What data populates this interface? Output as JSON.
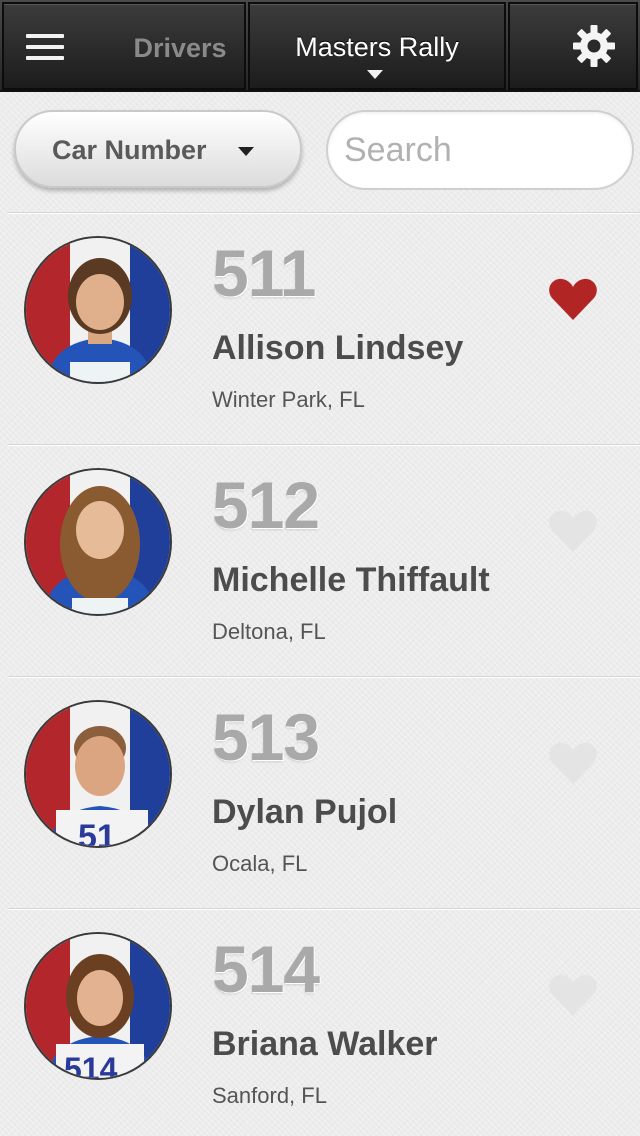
{
  "header": {
    "back_label": "Drivers",
    "title": "Masters Rally",
    "menu_icon": "hamburger-menu-icon",
    "settings_icon": "gear-icon"
  },
  "filters": {
    "sort_label": "Car Number",
    "search_placeholder": "Search",
    "search_value": ""
  },
  "colors": {
    "favorite_on": "#b22525",
    "favorite_off": "#e4e4e4",
    "number_gray": "#a9a9a9"
  },
  "drivers": [
    {
      "number": "511",
      "name": "Allison Lindsey",
      "location": "Winter Park, FL",
      "favorite": true
    },
    {
      "number": "512",
      "name": "Michelle Thiffault",
      "location": "Deltona, FL",
      "favorite": false
    },
    {
      "number": "513",
      "name": "Dylan Pujol",
      "location": "Ocala, FL",
      "favorite": false
    },
    {
      "number": "514",
      "name": "Briana Walker",
      "location": "Sanford, FL",
      "favorite": false
    }
  ]
}
